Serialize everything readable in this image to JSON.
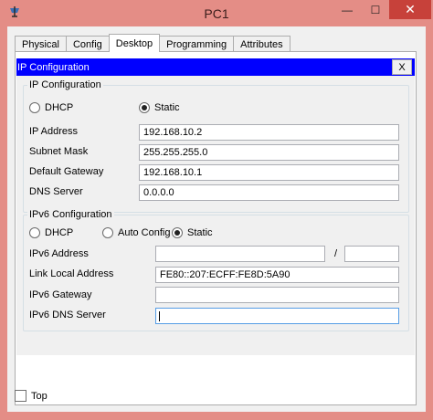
{
  "window": {
    "title": "PC1",
    "minimize_glyph": "—",
    "maximize_glyph": "☐",
    "close_glyph": "✕"
  },
  "tabs": [
    {
      "label": "Physical",
      "active": false
    },
    {
      "label": "Config",
      "active": false
    },
    {
      "label": "Desktop",
      "active": true
    },
    {
      "label": "Programming",
      "active": false
    },
    {
      "label": "Attributes",
      "active": false
    }
  ],
  "ip_config": {
    "header": "IP Configuration",
    "close_label": "X",
    "ipv4": {
      "group_title": "IP Configuration",
      "dhcp_label": "DHCP",
      "static_label": "Static",
      "selected": "static",
      "ip_address_label": "IP Address",
      "ip_address": "192.168.10.2",
      "subnet_mask_label": "Subnet Mask",
      "subnet_mask": "255.255.255.0",
      "default_gateway_label": "Default Gateway",
      "default_gateway": "192.168.10.1",
      "dns_server_label": "DNS Server",
      "dns_server": "0.0.0.0"
    },
    "ipv6": {
      "group_title": "IPv6 Configuration",
      "dhcp_label": "DHCP",
      "auto_config_label": "Auto Config",
      "static_label": "Static",
      "selected": "static",
      "address_label": "IPv6 Address",
      "address": "",
      "prefix_separator": "/",
      "prefix": "",
      "link_local_label": "Link Local Address",
      "link_local": "FE80::207:ECFF:FE8D:5A90",
      "gateway_label": "IPv6 Gateway",
      "gateway": "",
      "dns_server_label": "IPv6 DNS Server",
      "dns_server": ""
    }
  },
  "footer": {
    "top_label": "Top",
    "top_checked": false
  },
  "colors": {
    "title_bar": "#e48d86",
    "close_button": "#c7413a",
    "ip_header": "#0000ff"
  }
}
